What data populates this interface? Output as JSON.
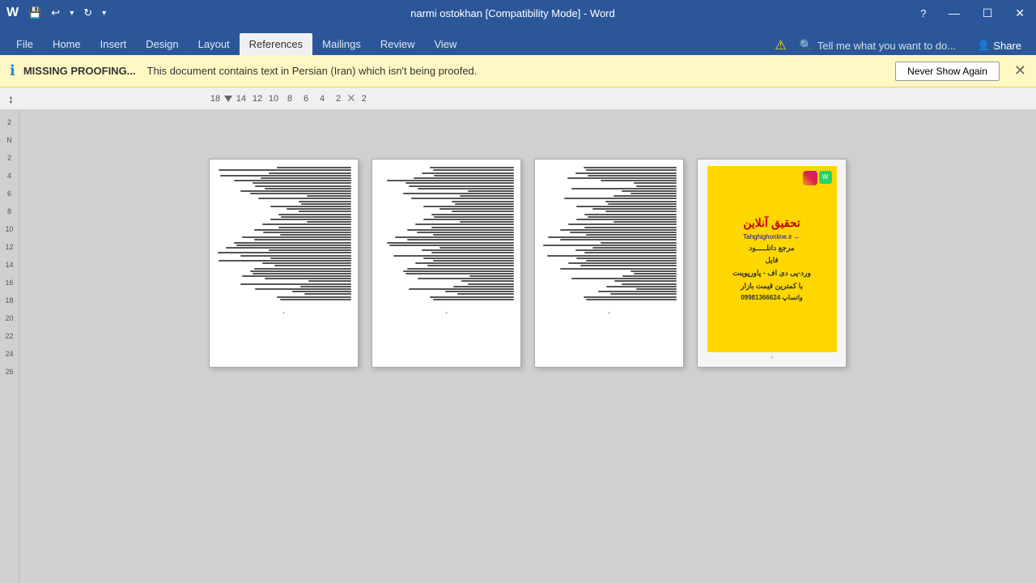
{
  "titlebar": {
    "title": "narmi ostokhan [Compatibility Mode] - Word",
    "minimize": "—",
    "maximize": "☐",
    "close": "✕",
    "restore_icon": "⧉"
  },
  "quickaccess": {
    "save": "💾",
    "undo": "↩",
    "undo_arrow": "▾",
    "redo": "↻",
    "more": "▾"
  },
  "tabs": [
    {
      "label": "File",
      "active": false
    },
    {
      "label": "Home",
      "active": false
    },
    {
      "label": "Insert",
      "active": false
    },
    {
      "label": "Design",
      "active": false
    },
    {
      "label": "Layout",
      "active": false
    },
    {
      "label": "References",
      "active": true
    },
    {
      "label": "Mailings",
      "active": false
    },
    {
      "label": "Review",
      "active": false
    },
    {
      "label": "View",
      "active": false
    }
  ],
  "tell_me": "Tell me what you want to do...",
  "share_label": "Share",
  "notification": {
    "icon": "ℹ",
    "title": "MISSING PROOFING...",
    "message": "This document contains text in Persian (Iran) which isn't being proofed.",
    "button": "Never Show Again",
    "close": "✕"
  },
  "ruler": {
    "numbers": [
      "18",
      "14",
      "12",
      "10",
      "8",
      "6",
      "4",
      "2",
      "2"
    ],
    "cursor": "↕"
  },
  "sidebar": {
    "page_numbers": [
      "2",
      "N",
      "2",
      "4",
      "6",
      "8",
      "10",
      "12",
      "14",
      "16",
      "18",
      "20",
      "22",
      "24",
      "26"
    ]
  },
  "pages": [
    {
      "id": 1,
      "type": "text",
      "lines": 52
    },
    {
      "id": 2,
      "type": "text",
      "lines": 52
    },
    {
      "id": 3,
      "type": "text",
      "lines": 52
    },
    {
      "id": 4,
      "type": "ad"
    }
  ],
  "ad": {
    "title": "تحقیق آنلاین",
    "url": "Tahghighonline.ir",
    "arrow": "←",
    "line1": "مرجع دانلـــــود",
    "line2": "فایل",
    "line3": "ورد-پی دی اف - پاورپوینت",
    "line4": "با کمترین قیمت بازار",
    "phone": "واتساپ 09981366624"
  },
  "footer_dots": "•"
}
